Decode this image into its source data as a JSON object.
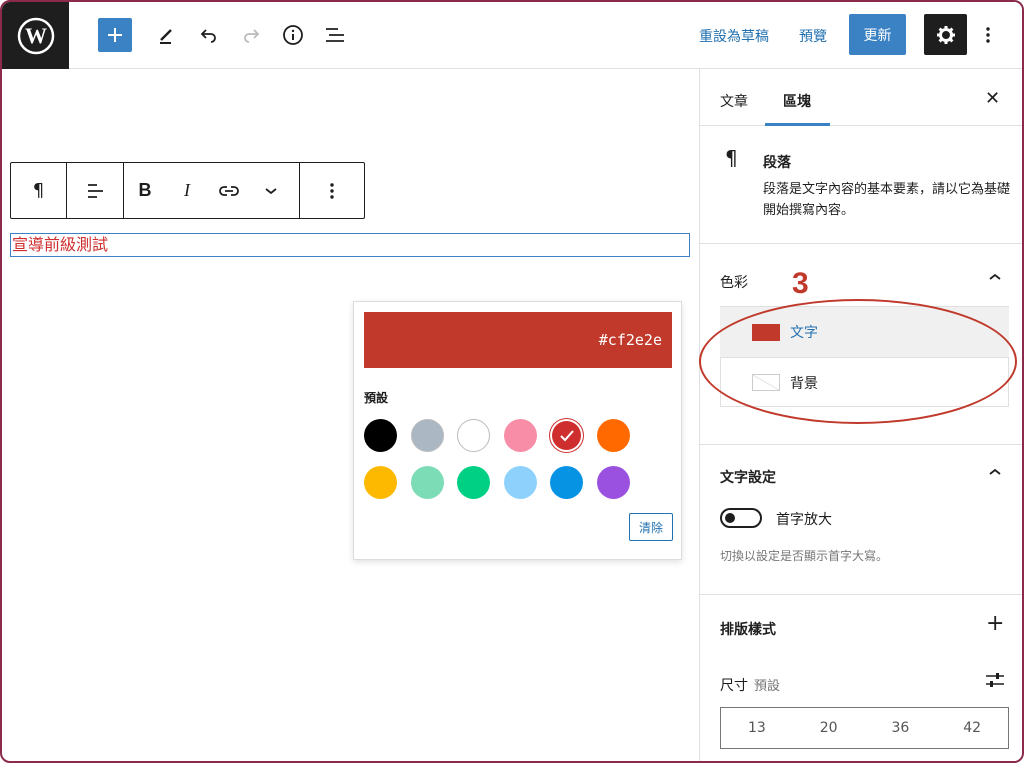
{
  "topbar": {
    "revert_label": "重設為草稿",
    "preview_label": "預覽",
    "update_label": "更新"
  },
  "editor": {
    "paragraph_text": "宣導前級測試",
    "toolbar": {
      "bold": "B",
      "italic": "I"
    }
  },
  "color_popover": {
    "hex_value": "#cf2e2e",
    "preset_label": "預設",
    "clear_label": "清除",
    "swatches": [
      "#000000",
      "#abb8c3",
      "#ffffff",
      "#f78da7",
      "#cf2e2e",
      "#ff6900",
      "#fcb900",
      "#7bdcb5",
      "#00d084",
      "#8ed1fc",
      "#0693e3",
      "#9b51e0"
    ],
    "selected_index": 4
  },
  "sidebar": {
    "tabs": [
      "文章",
      "區塊"
    ],
    "active_tab": "區塊",
    "block": {
      "name": "段落",
      "description": "段落是文字內容的基本要素，請以它為基礎開始撰寫內容。"
    },
    "color": {
      "heading": "色彩",
      "text_label": "文字",
      "background_label": "背景",
      "text_color": "#cf2e2e"
    },
    "text_settings": {
      "heading": "文字設定",
      "dropcap_label": "首字放大",
      "help": "切換以設定是否顯示首字大寫。"
    },
    "typography": {
      "heading": "排版樣式",
      "size_label": "尺寸",
      "size_value": "預設",
      "sizes": [
        "13",
        "20",
        "36",
        "42"
      ]
    }
  },
  "annotation": {
    "number": "3"
  }
}
